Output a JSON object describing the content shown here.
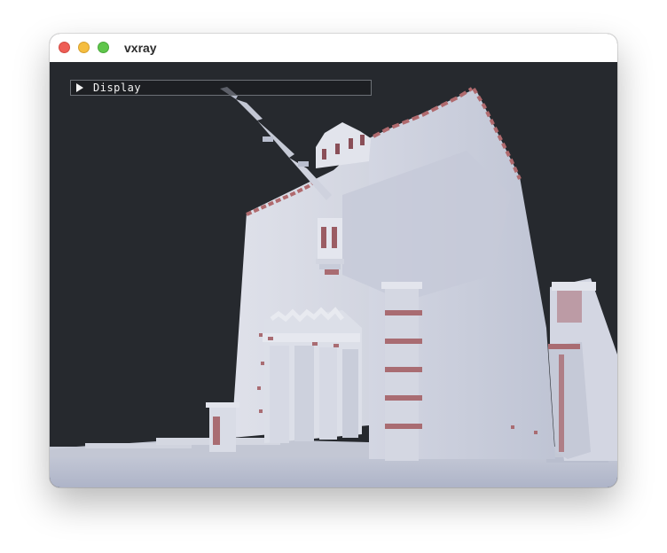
{
  "window": {
    "title": "vxray"
  },
  "panel": {
    "label": "Display",
    "state": "collapsed",
    "arrow_icon": "triangle-right-icon"
  },
  "scene": {
    "description_icon": "voxel-castle-render",
    "background_color": "#26292e",
    "stone_color": "#d9dbe4",
    "shadow_color": "#a8aec2",
    "trim_color": "#b06a6e"
  }
}
